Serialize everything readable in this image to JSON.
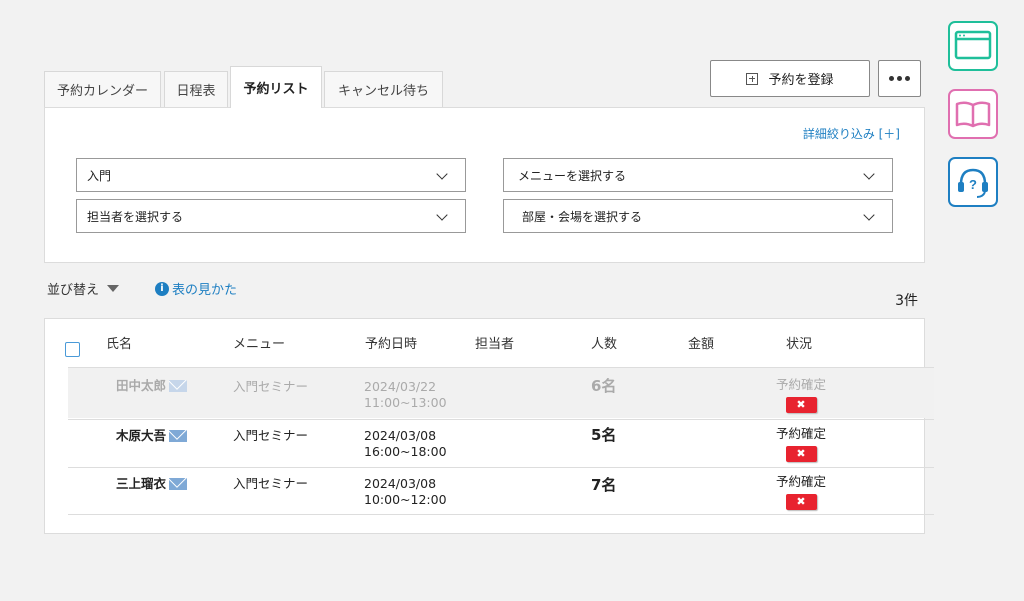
{
  "tabs": [
    {
      "label": "予約カレンダー",
      "active": false
    },
    {
      "label": "日程表",
      "active": false
    },
    {
      "label": "予約リスト",
      "active": true
    },
    {
      "label": "キャンセル待ち",
      "active": false
    }
  ],
  "actions": {
    "register_label": "予約を登録"
  },
  "filters": {
    "detail_link": "詳細絞り込み [＋]",
    "category": "入門",
    "menu": "メニューを選択する",
    "staff": "担当者を選択する",
    "room": "部屋・会場を選択する"
  },
  "toolbar": {
    "sort_label": "並び替え",
    "howto_label": "表の見かた",
    "count": "3件"
  },
  "table": {
    "headers": {
      "name": "氏名",
      "menu": "メニュー",
      "datetime": "予約日時",
      "staff": "担当者",
      "people": "人数",
      "amount": "金額",
      "status": "状況"
    },
    "rows": [
      {
        "name": "田中太郎",
        "menu": "入門セミナー",
        "date": "2024/03/22",
        "time": "11:00~13:00",
        "staff": "",
        "people": "6名",
        "amount": "",
        "status": "予約確定",
        "cancel": "✖",
        "dimmed": true
      },
      {
        "name": "木原大吾",
        "menu": "入門セミナー",
        "date": "2024/03/08",
        "time": "16:00~18:00",
        "staff": "",
        "people": "5名",
        "amount": "",
        "status": "予約確定",
        "cancel": "✖",
        "dimmed": false
      },
      {
        "name": "三上瑠衣",
        "menu": "入門セミナー",
        "date": "2024/03/08",
        "time": "10:00~12:00",
        "staff": "",
        "people": "7名",
        "amount": "",
        "status": "予約確定",
        "cancel": "✖",
        "dimmed": false
      }
    ]
  },
  "sidebar": {
    "icons": [
      {
        "icon": "browser-window-icon",
        "color": "#1fbf9a"
      },
      {
        "icon": "book-icon",
        "color": "#e06fb0"
      },
      {
        "icon": "headset-help-icon",
        "color": "#1e7fc2"
      }
    ]
  },
  "colors": {
    "link": "#1e7fc2",
    "cancel_red": "#e8232f",
    "panel_bg": "#ffffff",
    "page_bg": "#f2f2f2"
  }
}
